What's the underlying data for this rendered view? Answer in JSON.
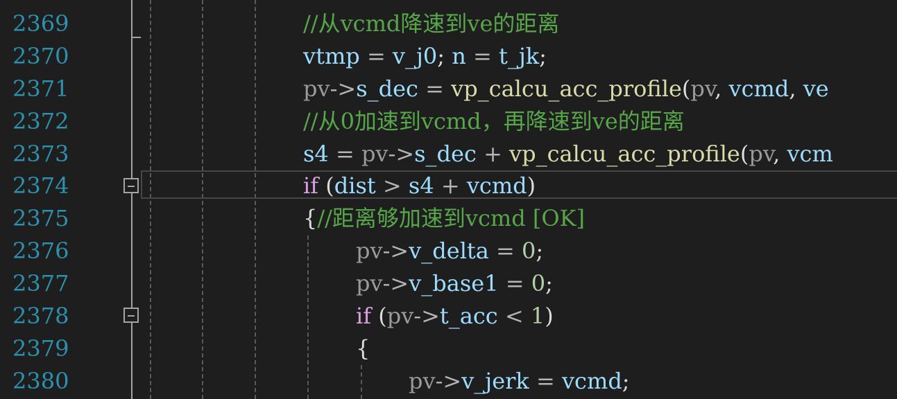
{
  "colors": {
    "background": "#1e1e1e",
    "line_number": "#2b91af",
    "keyword": "#d8a0df",
    "variable": "#9cdcfe",
    "function": "#dcdcaa",
    "comment": "#57a64a",
    "number": "#b5cea8"
  },
  "lines": [
    {
      "number": "2369",
      "tokens": [
        {
          "t": "//从vcmd降速到ve的距离",
          "c": "cm"
        }
      ]
    },
    {
      "number": "2370",
      "tokens": [
        {
          "t": "vtmp",
          "c": "var"
        },
        {
          "t": " = ",
          "c": "op"
        },
        {
          "t": "v_j0",
          "c": "var"
        },
        {
          "t": "; ",
          "c": "txt"
        },
        {
          "t": "n",
          "c": "var"
        },
        {
          "t": " = ",
          "c": "op"
        },
        {
          "t": "t_jk",
          "c": "var"
        },
        {
          "t": ";",
          "c": "txt"
        }
      ]
    },
    {
      "number": "2371",
      "tokens": [
        {
          "t": "pv",
          "c": "pv"
        },
        {
          "t": "->",
          "c": "op"
        },
        {
          "t": "s_dec",
          "c": "var"
        },
        {
          "t": " = ",
          "c": "op"
        },
        {
          "t": "vp_calcu_acc_profile",
          "c": "fn"
        },
        {
          "t": "(",
          "c": "txt"
        },
        {
          "t": "pv",
          "c": "pv"
        },
        {
          "t": ", ",
          "c": "txt"
        },
        {
          "t": "vcmd",
          "c": "var"
        },
        {
          "t": ", ",
          "c": "txt"
        },
        {
          "t": "ve",
          "c": "var"
        }
      ]
    },
    {
      "number": "2372",
      "tokens": [
        {
          "t": "//从0加速到vcmd，再降速到ve的距离",
          "c": "cm"
        }
      ]
    },
    {
      "number": "2373",
      "tokens": [
        {
          "t": "s4",
          "c": "var"
        },
        {
          "t": " = ",
          "c": "op"
        },
        {
          "t": "pv",
          "c": "pv"
        },
        {
          "t": "->",
          "c": "op"
        },
        {
          "t": "s_dec",
          "c": "var"
        },
        {
          "t": " + ",
          "c": "op"
        },
        {
          "t": "vp_calcu_acc_profile",
          "c": "fn"
        },
        {
          "t": "(",
          "c": "txt"
        },
        {
          "t": "pv",
          "c": "pv"
        },
        {
          "t": ", ",
          "c": "txt"
        },
        {
          "t": "vcm",
          "c": "var"
        }
      ]
    },
    {
      "number": "2374",
      "tokens": [
        {
          "t": "if",
          "c": "kw"
        },
        {
          "t": " (",
          "c": "txt"
        },
        {
          "t": "dist",
          "c": "var"
        },
        {
          "t": " > ",
          "c": "op"
        },
        {
          "t": "s4",
          "c": "var"
        },
        {
          "t": " + ",
          "c": "op"
        },
        {
          "t": "vcmd",
          "c": "var"
        },
        {
          "t": ")",
          "c": "txt"
        }
      ]
    },
    {
      "number": "2375",
      "tokens": [
        {
          "t": "{",
          "c": "txt"
        },
        {
          "t": "//距离够加速到vcmd [OK]",
          "c": "cm"
        }
      ]
    },
    {
      "number": "2376",
      "tokens": [
        {
          "t": "pv",
          "c": "pv"
        },
        {
          "t": "->",
          "c": "op"
        },
        {
          "t": "v_delta",
          "c": "var"
        },
        {
          "t": " = ",
          "c": "op"
        },
        {
          "t": "0",
          "c": "num"
        },
        {
          "t": ";",
          "c": "txt"
        }
      ]
    },
    {
      "number": "2377",
      "tokens": [
        {
          "t": "pv",
          "c": "pv"
        },
        {
          "t": "->",
          "c": "op"
        },
        {
          "t": "v_base1",
          "c": "var"
        },
        {
          "t": " = ",
          "c": "op"
        },
        {
          "t": "0",
          "c": "num"
        },
        {
          "t": ";",
          "c": "txt"
        }
      ]
    },
    {
      "number": "2378",
      "tokens": [
        {
          "t": "if",
          "c": "kw"
        },
        {
          "t": " (",
          "c": "txt"
        },
        {
          "t": "pv",
          "c": "pv"
        },
        {
          "t": "->",
          "c": "op"
        },
        {
          "t": "t_acc",
          "c": "var"
        },
        {
          "t": " < ",
          "c": "op"
        },
        {
          "t": "1",
          "c": "num"
        },
        {
          "t": ")",
          "c": "txt"
        }
      ]
    },
    {
      "number": "2379",
      "tokens": [
        {
          "t": "{",
          "c": "txt"
        }
      ]
    },
    {
      "number": "2380",
      "tokens": [
        {
          "t": "pv",
          "c": "pv"
        },
        {
          "t": "->",
          "c": "op"
        },
        {
          "t": "v_jerk",
          "c": "var"
        },
        {
          "t": " = ",
          "c": "op"
        },
        {
          "t": "vcmd",
          "c": "var"
        },
        {
          "t": ";",
          "c": "txt"
        }
      ]
    }
  ]
}
